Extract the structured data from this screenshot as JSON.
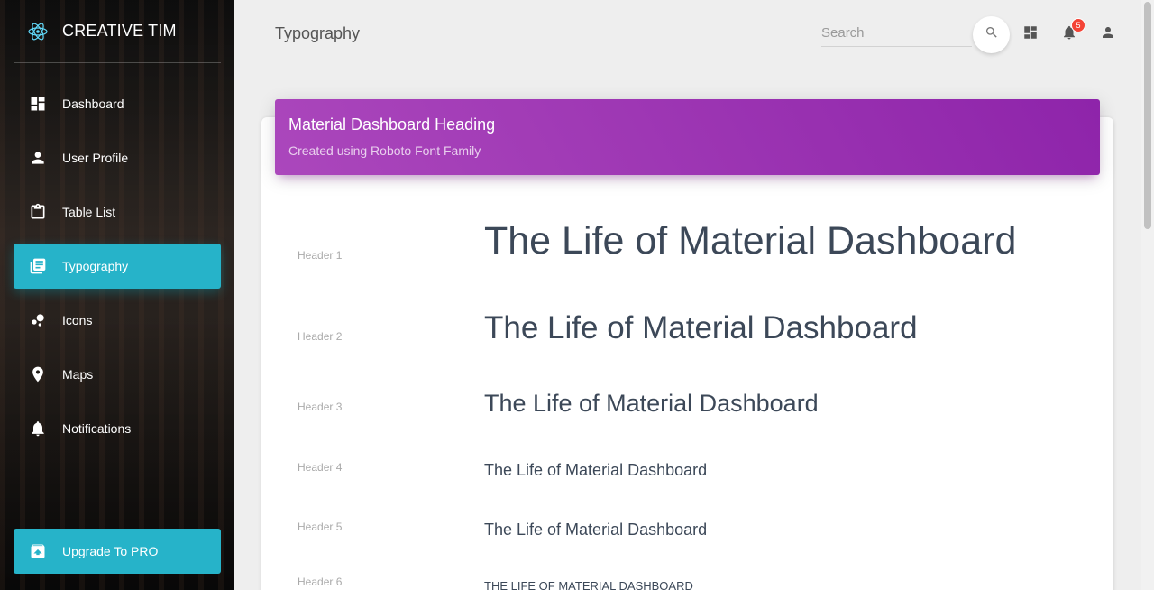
{
  "brand": {
    "name": "CREATIVE TIM",
    "logo_icon": "react-atom-icon"
  },
  "sidebar": {
    "items": [
      {
        "label": "Dashboard",
        "icon": "dashboard-icon"
      },
      {
        "label": "User Profile",
        "icon": "person-icon"
      },
      {
        "label": "Table List",
        "icon": "clipboard-icon"
      },
      {
        "label": "Typography",
        "icon": "library-books-icon",
        "active": true
      },
      {
        "label": "Icons",
        "icon": "bubble-chart-icon"
      },
      {
        "label": "Maps",
        "icon": "location-pin-icon"
      },
      {
        "label": "Notifications",
        "icon": "bell-icon"
      }
    ],
    "upgrade": {
      "label": "Upgrade To PRO",
      "icon": "unarchive-icon"
    },
    "accent_color": "#26b3c9"
  },
  "topbar": {
    "title": "Typography",
    "search_placeholder": "Search",
    "notification_count": "5"
  },
  "card": {
    "title": "Material Dashboard Heading",
    "category": "Created using Roboto Font Family",
    "header_color": "#9c27b0",
    "rows": [
      {
        "label": "Header 1",
        "text": "The Life of Material Dashboard"
      },
      {
        "label": "Header 2",
        "text": "The Life of Material Dashboard"
      },
      {
        "label": "Header 3",
        "text": "The Life of Material Dashboard"
      },
      {
        "label": "Header 4",
        "text": "The Life of Material Dashboard"
      },
      {
        "label": "Header 5",
        "text": "The Life of Material Dashboard"
      },
      {
        "label": "Header 6",
        "text": "THE LIFE OF MATERIAL DASHBOARD"
      }
    ]
  }
}
